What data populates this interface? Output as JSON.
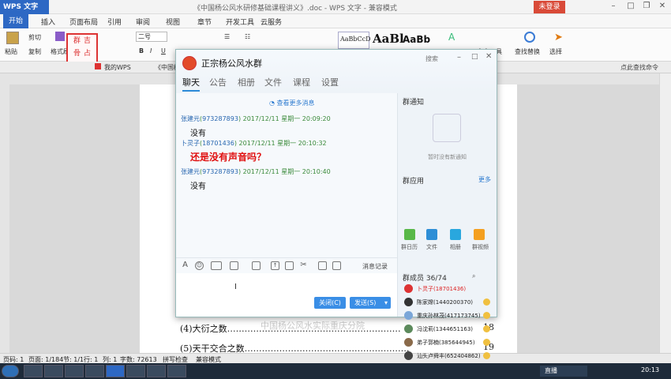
{
  "app": {
    "logo_label": "WPS 文字",
    "doc_title": "《中国杨公风水研修基础课程讲义》.doc - WPS 文字 - 兼容模式",
    "login_label": "未登录"
  },
  "menu": {
    "items": [
      "开始",
      "插入",
      "页面布局",
      "引用",
      "审阅",
      "视图",
      "章节",
      "开发工具",
      "云服务"
    ]
  },
  "ribbon": {
    "paste": "粘贴",
    "cut": "剪切",
    "copy": "复制",
    "format_painter": "格式刷",
    "font_size": "二号",
    "style1": "AaBbCcD",
    "style2": "AaBl",
    "style3": "AaBb",
    "find_replace": "查找替换",
    "select": "选择",
    "text_tools": "文字工具",
    "title_label": "标题"
  },
  "tabs": {
    "items": [
      "我的WPS",
      "《中国杨"
    ],
    "search_placeholder": "点此查找命令"
  },
  "toc": [
    {
      "text": "(4)大衍之数",
      "page": "18"
    },
    {
      "text": "(5)天干交合之数",
      "page": "19"
    }
  ],
  "watermark": "中国杨公风水实际重庆分院",
  "status": {
    "page": "页码: 1",
    "pages": "页面: 1/184",
    "section": "节: 1/1",
    "row": "行: 1",
    "col": "列: 1",
    "words": "字数: 72613",
    "spell": "拼写检查",
    "compat": "兼容模式"
  },
  "qq": {
    "group_name": "正宗杨公风水群",
    "header_menu": "搜索",
    "tabs": [
      "聊天",
      "公告",
      "相册",
      "文件",
      "课程",
      "设置"
    ],
    "more_msgs": "查看更多消息",
    "messages": [
      {
        "who": "张建元",
        "qq": "973287893",
        "time": "2017/12/11 星期一 20:09:20",
        "text": "没有"
      },
      {
        "who": "卜灵子",
        "qq": "18701436",
        "time": "2017/12/11 星期一 20:10:32",
        "text": "还是没有声音吗？"
      },
      {
        "who": "张建元",
        "qq": "973287893",
        "time": "2017/12/11 星期一 20:10:40",
        "text": "没有"
      }
    ],
    "msg_record": "消息记录",
    "close_btn": "关闭(C)",
    "send_btn": "发送(S)",
    "notice_title": "群通知",
    "notice_empty": "暂时没有新通知",
    "apps_title": "群应用",
    "apps_more": "更多",
    "apps": [
      "群日历",
      "文件",
      "相册",
      "群视频"
    ],
    "members_title": "群成员 36/74",
    "members": [
      "卜灵子(18701436)",
      "陈家嫦(1440200370)",
      "重庆孙林茂(417173745)",
      "冯沈莉(1344651163)",
      "弟子郭楠(385644945)",
      "汕头卢舜丰(652404862)"
    ]
  },
  "stamp": {
    "text": "群骨占吉"
  },
  "taskbar": {
    "live": "直播",
    "clock": "20:13"
  }
}
